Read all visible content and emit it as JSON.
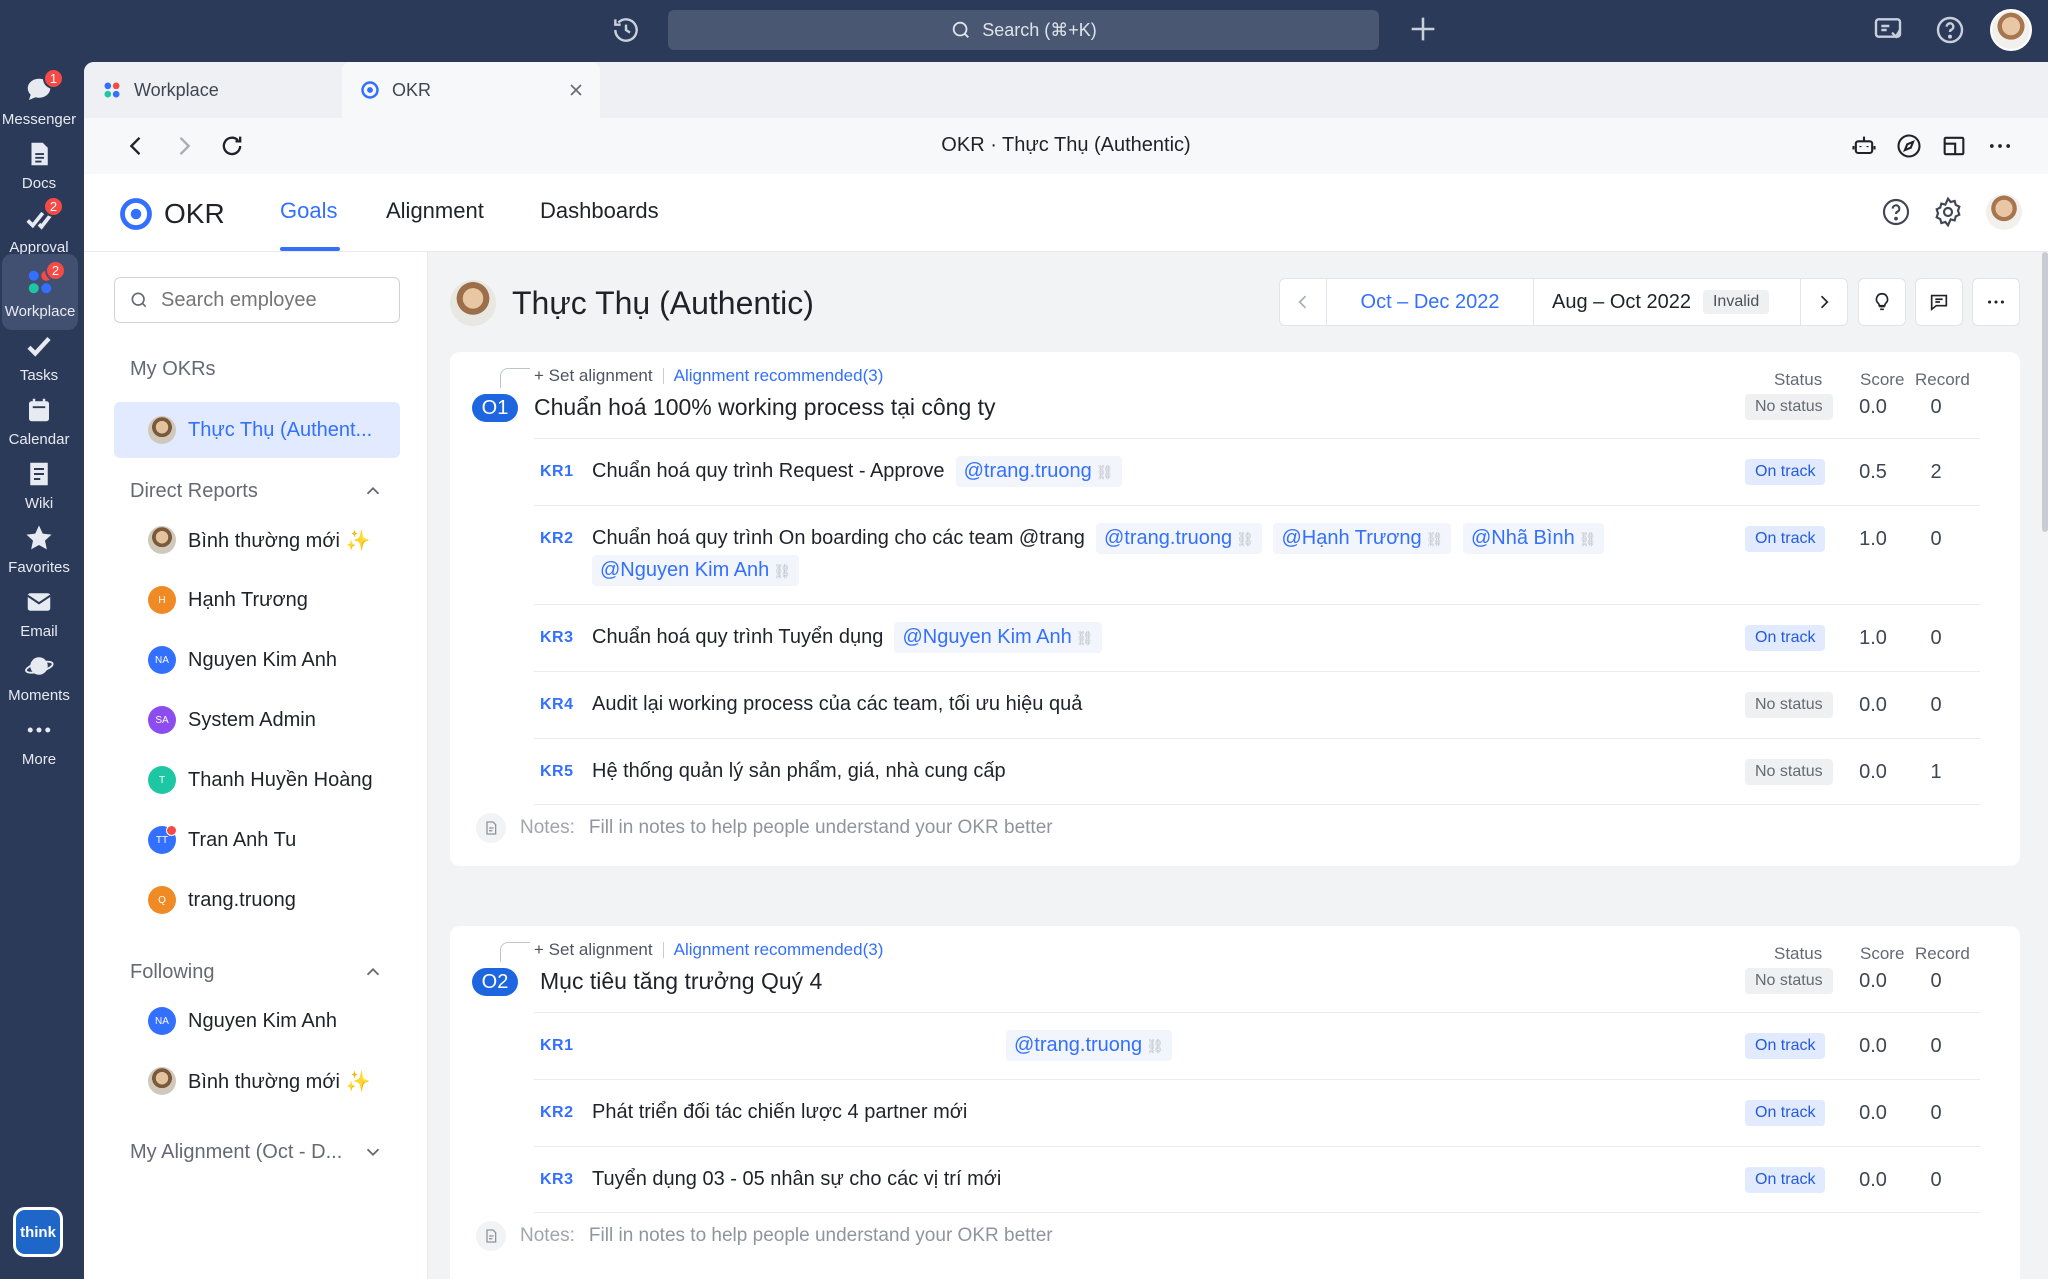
{
  "topbar": {
    "search_label": "Search (⌘+K)"
  },
  "leftnav": {
    "items": [
      {
        "label": "Messenger",
        "badge": "1"
      },
      {
        "label": "Docs",
        "badge": ""
      },
      {
        "label": "Approval",
        "badge": "2"
      },
      {
        "label": "Workplace",
        "badge": "2"
      },
      {
        "label": "Tasks",
        "badge": ""
      },
      {
        "label": "Calendar",
        "badge": ""
      },
      {
        "label": "Wiki",
        "badge": ""
      },
      {
        "label": "Favorites",
        "badge": ""
      },
      {
        "label": "Email",
        "badge": ""
      },
      {
        "label": "Moments",
        "badge": ""
      },
      {
        "label": "More",
        "badge": ""
      }
    ],
    "logo_text": "think"
  },
  "tabs": [
    {
      "label": "Workplace"
    },
    {
      "label": "OKR"
    }
  ],
  "address": {
    "title": "OKR · Thực Thụ (Authentic)"
  },
  "app": {
    "logo_text": "OKR",
    "tabs": [
      {
        "label": "Goals"
      },
      {
        "label": "Alignment"
      },
      {
        "label": "Dashboards"
      }
    ]
  },
  "sidebar": {
    "search_placeholder": "Search employee",
    "my_okrs_title": "My OKRs",
    "my_okrs_item": "Thực Thụ (Authent...",
    "direct_reports_title": "Direct Reports",
    "direct_reports": [
      {
        "name": "Bình thường mới ✨",
        "initials": "",
        "color": ""
      },
      {
        "name": "Hạnh Trương",
        "initials": "H",
        "color": "#f08a24"
      },
      {
        "name": "Nguyen Kim Anh",
        "initials": "NA",
        "color": "#3370ff"
      },
      {
        "name": "System Admin",
        "initials": "SA",
        "color": "#8b4cf0"
      },
      {
        "name": "Thanh Huyền Hoàng",
        "initials": "T",
        "color": "#1ec7a4"
      },
      {
        "name": "Tran Anh Tu",
        "initials": "TT",
        "color": "#3370ff"
      },
      {
        "name": "trang.truong",
        "initials": "Q",
        "color": "#f08a24"
      }
    ],
    "following_title": "Following",
    "following": [
      {
        "name": "Nguyen Kim Anh",
        "initials": "NA",
        "color": "#3370ff"
      },
      {
        "name": "Bình thường mới ✨",
        "initials": "",
        "color": ""
      }
    ],
    "alignment_title": "My Alignment (Oct - D..."
  },
  "main": {
    "person_name": "Thực Thụ (Authentic)",
    "period_current": "Oct – Dec 2022",
    "period_other": "Aug – Oct 2022",
    "period_badge": "Invalid",
    "col_status": "Status",
    "col_score": "Score",
    "col_record": "Record",
    "set_alignment": "Set alignment",
    "alignment_recommended": "Alignment recommended(3)",
    "notes_label": "Notes:",
    "notes_placeholder": "Fill in notes to help people understand your OKR better",
    "objectives": [
      {
        "badge": "O1",
        "title": "Chuẩn hoá 100% working process tại công ty",
        "status": "No status",
        "score": "0.0",
        "record": "0",
        "krs": [
          {
            "label": "KR1",
            "text": "Chuẩn hoá quy trình Request - Approve",
            "mentions": [
              "@trang.truong"
            ],
            "status": "On track",
            "score": "0.5",
            "record": "2"
          },
          {
            "label": "KR2",
            "text": "Chuẩn hoá quy trình On boarding cho các team @trang",
            "mentions": [
              "@trang.truong",
              "@Hạnh Trương",
              "@Nhã Bình",
              "@Nguyen Kim Anh"
            ],
            "status": "On track",
            "score": "1.0",
            "record": "0"
          },
          {
            "label": "KR3",
            "text": "Chuẩn hoá quy trình Tuyển dụng",
            "mentions": [
              "@Nguyen Kim Anh"
            ],
            "status": "On track",
            "score": "1.0",
            "record": "0"
          },
          {
            "label": "KR4",
            "text": "Audit lại working process của các team, tối ưu hiệu quả",
            "mentions": [],
            "status": "No status",
            "score": "0.0",
            "record": "0"
          },
          {
            "label": "KR5",
            "text": "Hệ thống quản lý sản phẩm, giá, nhà cung cấp",
            "mentions": [],
            "status": "No status",
            "score": "0.0",
            "record": "1"
          }
        ]
      },
      {
        "badge": "O2",
        "title": "Mục tiêu tăng trưởng Quý 4",
        "status": "No status",
        "score": "0.0",
        "record": "0",
        "krs": [
          {
            "label": "KR1",
            "text": "",
            "mentions": [
              "@trang.truong"
            ],
            "status": "On track",
            "score": "0.0",
            "record": "0"
          },
          {
            "label": "KR2",
            "text": "Phát triển đối tác chiến lược 4 partner mới",
            "mentions": [],
            "status": "On track",
            "score": "0.0",
            "record": "0"
          },
          {
            "label": "KR3",
            "text": "Tuyển dụng 03 - 05 nhân sự cho các vị trí mới",
            "mentions": [],
            "status": "On track",
            "score": "0.0",
            "record": "0"
          }
        ]
      }
    ]
  }
}
